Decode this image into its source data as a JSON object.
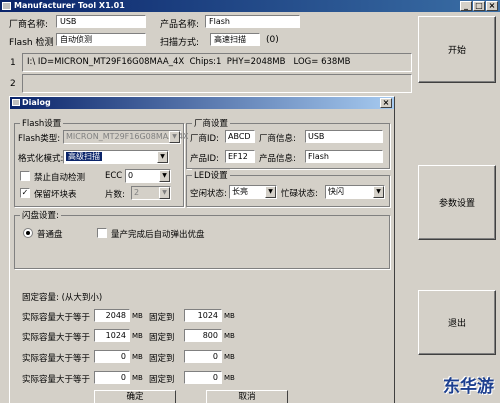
{
  "window": {
    "title": "Manufacturer Tool  X1.01"
  },
  "header": {
    "vendor_name_label": "厂商名称:",
    "vendor_name_value": "USB",
    "product_name_label": "产品名称:",
    "product_name_value": "Flash",
    "flash_detect_label": "Flash 检测",
    "flash_detect_value": "自动侦测",
    "scan_mode_label": "扫描方式:",
    "scan_mode_value": "高速扫描",
    "scan_mode_extra": "(0)"
  },
  "rows": [
    {
      "num": "1",
      "text": "I:\\ ID=MICRON_MT29F16G08MAA_4X  Chips:1  PHY=2048MB   LOG= 638MB"
    },
    {
      "num": "2",
      "text": ""
    }
  ],
  "buttons": {
    "start": "开始",
    "params": "参数设置",
    "exit": "退出"
  },
  "dialog": {
    "title": "Dialog",
    "flash_group": {
      "title": "Flash设置",
      "type_label": "Flash类型:",
      "type_value": "MICRON_MT29F16G08MAA_4X",
      "format_label": "格式化模式:",
      "format_value": "高级扫描",
      "auto_detect_label": "禁止自动检测",
      "auto_detect_checked": false,
      "keep_bad_label": "保留坏块表",
      "keep_bad_checked": true,
      "ecc_label": "ECC",
      "ecc_value": "0",
      "chips_label": "片数:",
      "chips_value": "2"
    },
    "vendor_group": {
      "title": "厂商设置",
      "vendor_id_label": "厂商ID:",
      "vendor_id_value": "ABCD",
      "vendor_info_label": "厂商信息:",
      "vendor_info_value": "USB",
      "product_id_label": "产品ID:",
      "product_id_value": "EF12",
      "product_info_label": "产品信息:",
      "product_info_value": "Flash"
    },
    "led_group": {
      "title": "LED设置",
      "idle_label": "空闲状态:",
      "idle_value": "长亮",
      "busy_label": "忙碌状态:",
      "busy_value": "快闪"
    },
    "flash_disk_group": {
      "title": "闪盘设置:",
      "normal_label": "普通盘",
      "normal_selected": true,
      "eject_label": "量产完成后自动弹出优盘",
      "eject_checked": false
    },
    "capacity": {
      "title": "固定容量: (从大到小)",
      "rows": [
        {
          "label": "实际容量大于等于",
          "size": "2048",
          "unit": "MB",
          "fixed_label": "固定到",
          "fixed": "1024",
          "fixed_unit": "MB"
        },
        {
          "label": "实际容量大于等于",
          "size": "1024",
          "unit": "MB",
          "fixed_label": "固定到",
          "fixed": "800",
          "fixed_unit": "MB"
        },
        {
          "label": "实际容量大于等于",
          "size": "0",
          "unit": "MB",
          "fixed_label": "固定到",
          "fixed": "0",
          "fixed_unit": "MB"
        },
        {
          "label": "实际容量大于等于",
          "size": "0",
          "unit": "MB",
          "fixed_label": "固定到",
          "fixed": "0",
          "fixed_unit": "MB"
        }
      ]
    },
    "ok_label": "确定",
    "cancel_label": "取消"
  },
  "watermark": "东华游"
}
